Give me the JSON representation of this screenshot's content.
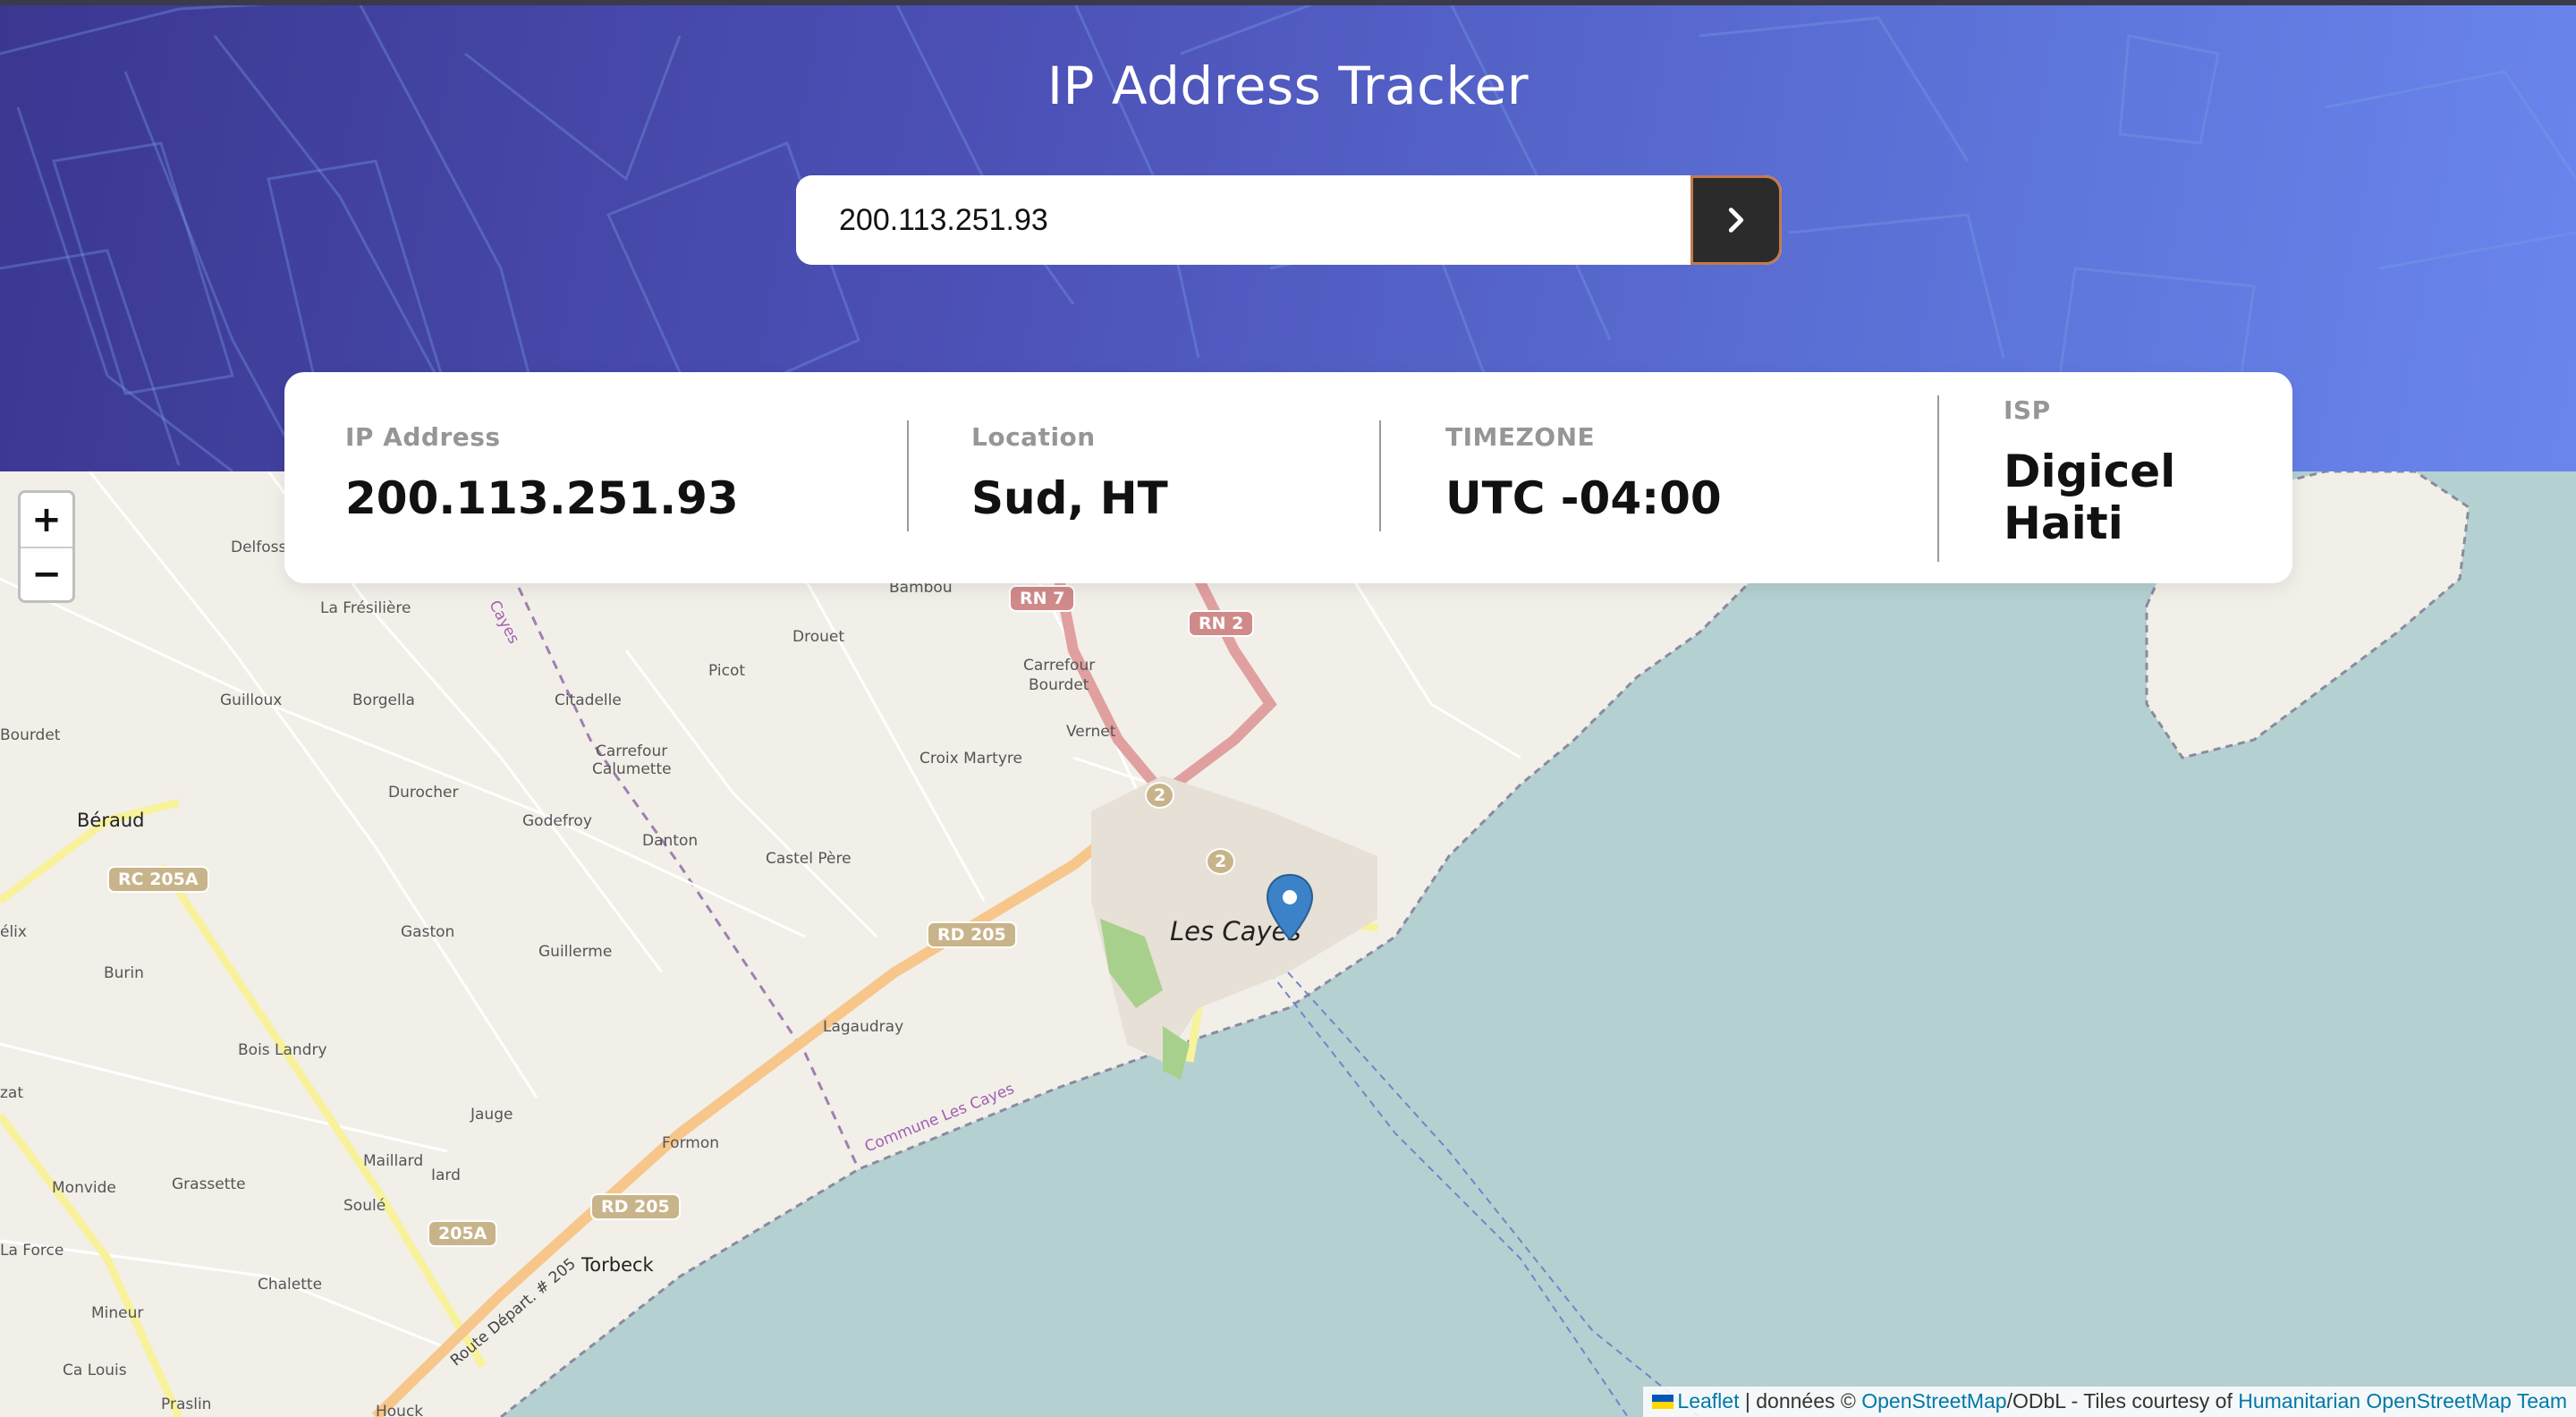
{
  "header": {
    "title": "IP Address Tracker"
  },
  "search": {
    "value": "200.113.251.93",
    "button_icon": "chevron-right-icon"
  },
  "info": {
    "ip": {
      "label": "IP Address",
      "value": "200.113.251.93"
    },
    "location": {
      "label": "Location",
      "value": "Sud, HT"
    },
    "timezone": {
      "label": "TIMEZONE",
      "value": "UTC -04:00"
    },
    "isp": {
      "label": "ISP",
      "value_line1": "Digicel",
      "value_line2": "Haiti"
    }
  },
  "map": {
    "zoom_in": "+",
    "zoom_out": "−",
    "marker_icon": "map-pin-icon",
    "places": {
      "les_cayes": "Les Cayes",
      "beraud": "Béraud",
      "torbeck": "Torbeck",
      "bambou": "Bambou",
      "delfoss": "Delfoss",
      "la_fresiliere": "La Frésilière",
      "guilloux": "Guilloux",
      "borgella": "Borgella",
      "citadelle": "Citadelle",
      "carrefour_calumette_1": "Carrefour",
      "carrefour_calumette_2": "Calumette",
      "drouet": "Drouet",
      "picot": "Picot",
      "carrefour_bourdet_1": "Carrefour",
      "carrefour_bourdet_2": "Bourdet",
      "vernet": "Vernet",
      "croix_martyre": "Croix Martyre",
      "bourdet": "Bourdet",
      "durocher": "Durocher",
      "godefroy": "Godefroy",
      "danton": "Danton",
      "castel_pere": "Castel Père",
      "elix": "élix",
      "gaston": "Gaston",
      "burin": "Burin",
      "guillerme": "Guillerme",
      "bois_landry": "Bois Landry",
      "lagaudray": "Lagaudray",
      "zat": "zat",
      "jauge": "Jauge",
      "formon": "Formon",
      "maillard": "Maillard",
      "iard": "Iard",
      "monvide": "Monvide",
      "grassette": "Grassette",
      "soule": "Soulé",
      "la_force": "La Force",
      "chalette": "Chalette",
      "mineur": "Mineur",
      "ca_louis": "Ca Louis",
      "praslin": "Praslin",
      "houck": "Houck",
      "commune": "Commune Les Cayes",
      "route_depart": "Route Départ. # 205",
      "cayes_boundary": "Cayes"
    },
    "shields": {
      "rn7": "RN 7",
      "rn2": "RN 2",
      "rc205a": "RC 205A",
      "rd205_a": "RD 205",
      "rd205_b": "RD 205",
      "r205a": "205A",
      "two_a": "2",
      "two_b": "2"
    }
  },
  "attribution": {
    "leaflet": "Leaflet",
    "sep1": " | données © ",
    "osm": "OpenStreetMap",
    "mid": "/ODbL - Tiles courtesy of ",
    "hot": "Humanitarian OpenStreetMap Team"
  },
  "colors": {
    "header_start": "#3b3791",
    "header_end": "#6a86ee",
    "button": "#2b2b2b",
    "sea": "#b5d0d0",
    "land": "#f2efe9"
  }
}
